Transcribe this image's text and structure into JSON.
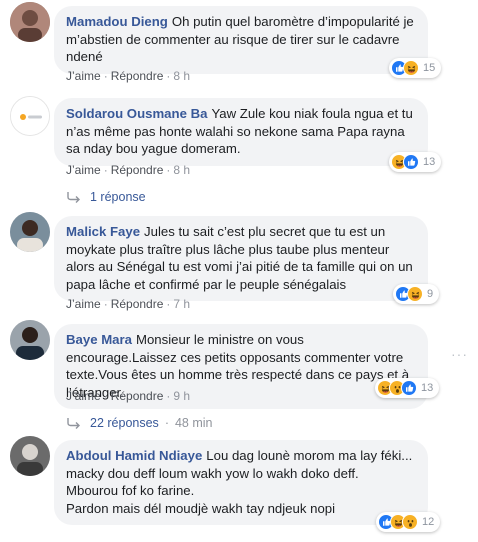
{
  "colors": {
    "author": "#385898",
    "bubble": "#f2f3f5",
    "meta": "#90949c",
    "like": "#2078f4",
    "haha": "#f7b125"
  },
  "ui": {
    "like_label": "J’aime",
    "reply_label": "Répondre",
    "separator": "·",
    "more_options_glyph": "···"
  },
  "comments": [
    {
      "author": "Mamadou Dieng",
      "text": "Oh putin quel baromètre d’impopularité je m’abstien de commenter au risque de tirer sur le cadavre ndené",
      "time": "8 h",
      "reactions": [
        "like-icon",
        "haha-icon"
      ],
      "reaction_count": "15"
    },
    {
      "author": "Soldarou Ousmane Ba",
      "text": "Yaw Zule kou niak foula ngua et tu n’as même pas honte walahi so nekone sama Papa rayna sa nday bou yague domeram.",
      "time": "8 h",
      "reactions": [
        "haha-icon",
        "like-icon"
      ],
      "reaction_count": "13",
      "replies_label": "1 réponse",
      "replies_time": ""
    },
    {
      "author": "Malick Faye",
      "text": "Jules tu sait c’est plu secret que tu est un moykate plus traître plus lâche plus taube plus menteur alors au Sénégal tu est vomi j’ai pitié de ta famille qui on un papa lâche et confirmé par le peuple sénégalais",
      "time": "7 h",
      "reactions": [
        "like-icon",
        "haha-icon"
      ],
      "reaction_count": "9"
    },
    {
      "author": "Baye Mara",
      "text": "Monsieur le ministre on vous encourage.Laissez ces petits opposants commenter votre texte.Vous êtes un homme très respecté dans ce pays et à l’étranger.",
      "time": "9 h",
      "reactions": [
        "haha-icon",
        "wow-icon",
        "like-icon"
      ],
      "reaction_count": "13",
      "replies_label": "22 réponses",
      "replies_time": "48 min"
    },
    {
      "author": "Abdoul Hamid Ndiaye",
      "text_lines": [
        "Lou dag lounè morom ma lay féki...",
        "macky dou deff loum wakh yow lo wakh doko deff.",
        "Mbourou fof ko farine.",
        "Pardon mais dél moudjè wakh tay ndjeuk nopi"
      ],
      "reactions": [
        "like-icon",
        "haha-icon",
        "wow-icon"
      ],
      "reaction_count": "12"
    }
  ]
}
